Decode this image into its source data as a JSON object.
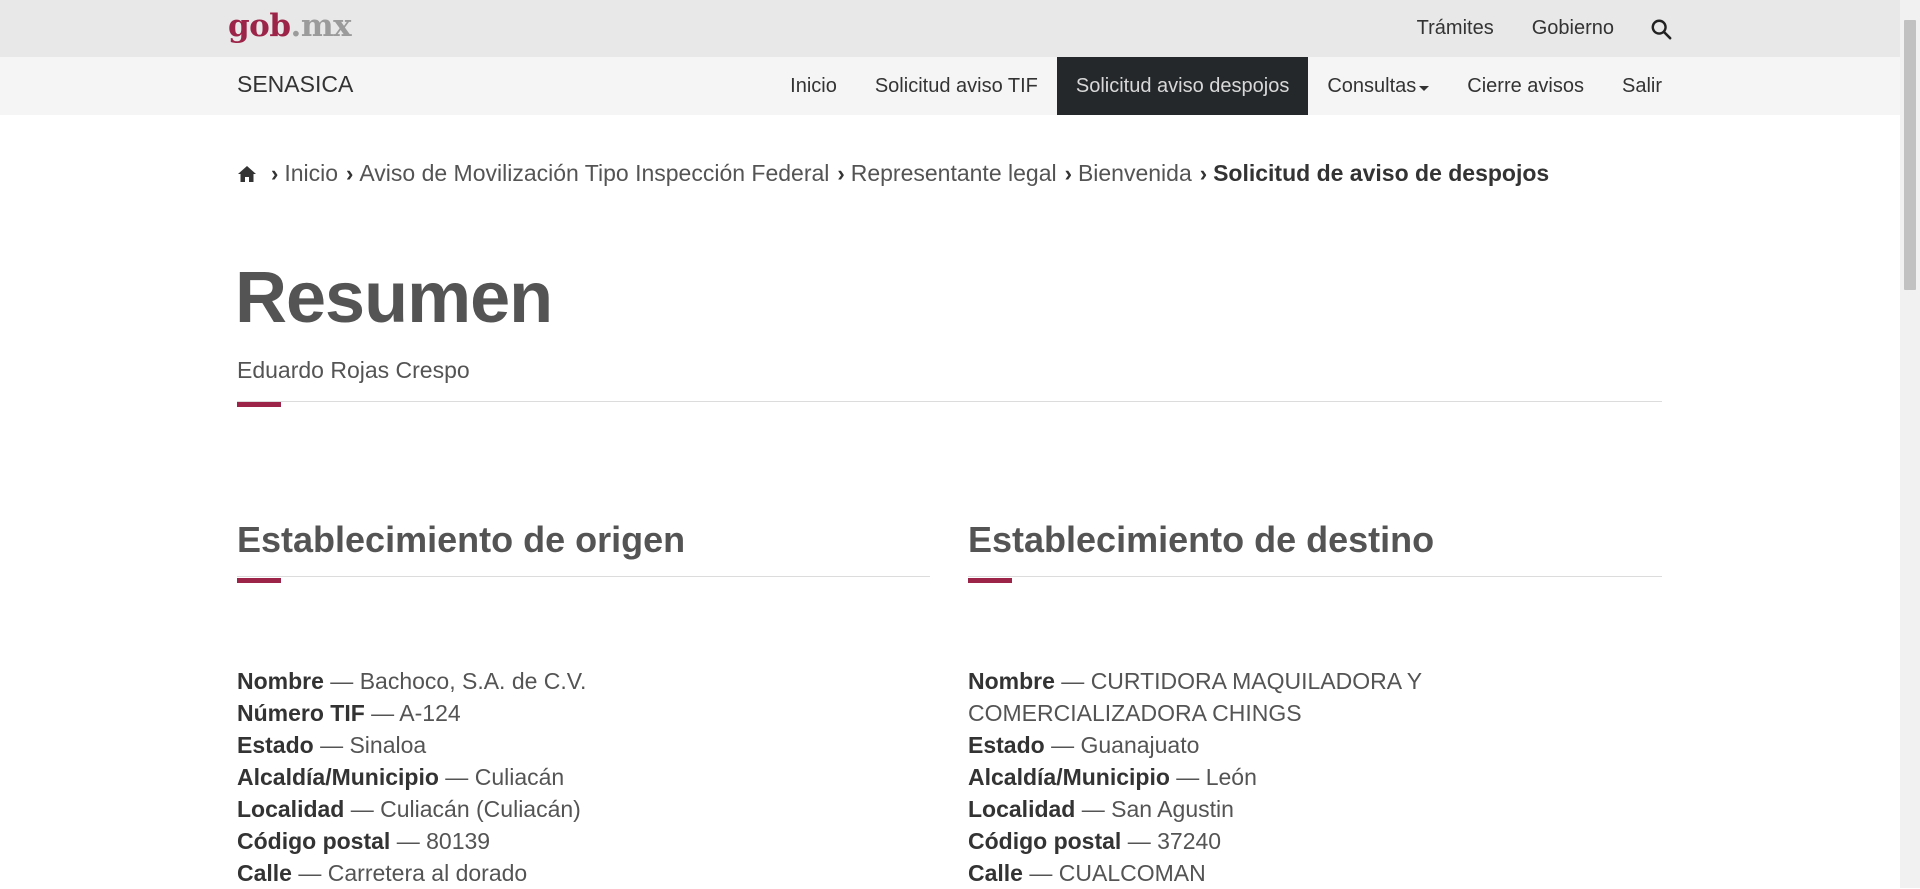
{
  "topbar": {
    "logo_a": "gob",
    "logo_b": ".mx",
    "links": [
      "Trámites",
      "Gobierno"
    ]
  },
  "navbar": {
    "brand": "SENASICA",
    "items": [
      {
        "label": "Inicio"
      },
      {
        "label": "Solicitud aviso TIF"
      },
      {
        "label": "Solicitud aviso despojos",
        "active": true
      },
      {
        "label": "Consultas"
      },
      {
        "label": "Cierre avisos"
      },
      {
        "label": "Salir"
      }
    ]
  },
  "breadcrumb": {
    "items": [
      "Inicio",
      "Aviso de Movilización Tipo Inspección Federal",
      "Representante legal",
      "Bienvenida"
    ],
    "current": "Solicitud de aviso de despojos"
  },
  "page": {
    "title": "Resumen",
    "subtitle": "Eduardo Rojas Crespo"
  },
  "origen": {
    "title": "Establecimiento de origen",
    "fields": [
      {
        "key": "Nombre",
        "value": "Bachoco, S.A. de C.V."
      },
      {
        "key": "Número TIF",
        "value": "A-124"
      },
      {
        "key": "Estado",
        "value": "Sinaloa"
      },
      {
        "key": "Alcaldía/Municipio",
        "value": "Culiacán"
      },
      {
        "key": "Localidad",
        "value": "Culiacán (Culiacán)"
      },
      {
        "key": "Código postal",
        "value": "80139"
      },
      {
        "key": "Calle",
        "value": "Carretera al dorado"
      }
    ]
  },
  "destino": {
    "title": "Establecimiento de destino",
    "fields": [
      {
        "key": "Nombre",
        "value": "CURTIDORA MAQUILADORA Y COMERCIALIZADORA CHINGS"
      },
      {
        "key": "Estado",
        "value": "Guanajuato"
      },
      {
        "key": "Alcaldía/Municipio",
        "value": "León"
      },
      {
        "key": "Localidad",
        "value": "San Agustin"
      },
      {
        "key": "Código postal",
        "value": "37240"
      },
      {
        "key": "Calle",
        "value": "CUALCOMAN"
      }
    ]
  },
  "colors": {
    "accent": "#9d2449",
    "topbar_bg": "#e8e8e8",
    "navbar_bg": "#f5f5f5",
    "nav_active_bg": "#24282b"
  }
}
